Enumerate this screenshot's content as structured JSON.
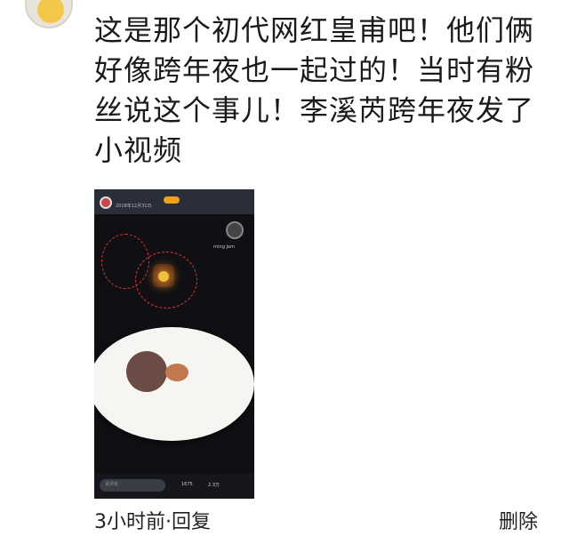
{
  "comment": {
    "text": "这是那个初代网红皇甫吧！他们俩好像跨年夜也一起过的！当时有粉丝说这个事儿！李溪芮跨年夜发了小视频"
  },
  "video": {
    "date": "2018年12月31日",
    "song": "rning Jam",
    "comment_input": "说评论",
    "comment_count": "1675",
    "like_count": "2.3万"
  },
  "footer": {
    "meta": "3小时前·回复",
    "delete_label": "删除"
  },
  "colors": {
    "background": "#ffffff",
    "text": "#1a1a1a",
    "annotation_circle": "#dd3333"
  }
}
